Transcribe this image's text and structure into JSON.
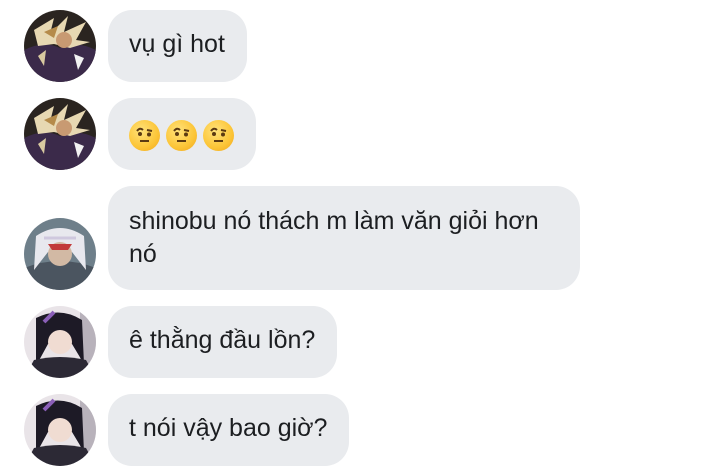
{
  "messages": [
    {
      "sender": "user-a",
      "text": "vụ gì hot"
    },
    {
      "sender": "user-a",
      "emojis": [
        "face-with-raised-eyebrow",
        "face-with-raised-eyebrow",
        "face-with-raised-eyebrow"
      ]
    },
    {
      "sender": "user-b",
      "text": "shinobu nó thách m làm văn giỏi hơn nó"
    },
    {
      "sender": "user-c",
      "text": "ê thằng đầu lồn?"
    },
    {
      "sender": "user-c",
      "text": "t nói vậy bao giờ?"
    }
  ],
  "colors": {
    "bubble_bg": "#e9ebee",
    "text": "#1c1e21",
    "background": "#ffffff"
  }
}
